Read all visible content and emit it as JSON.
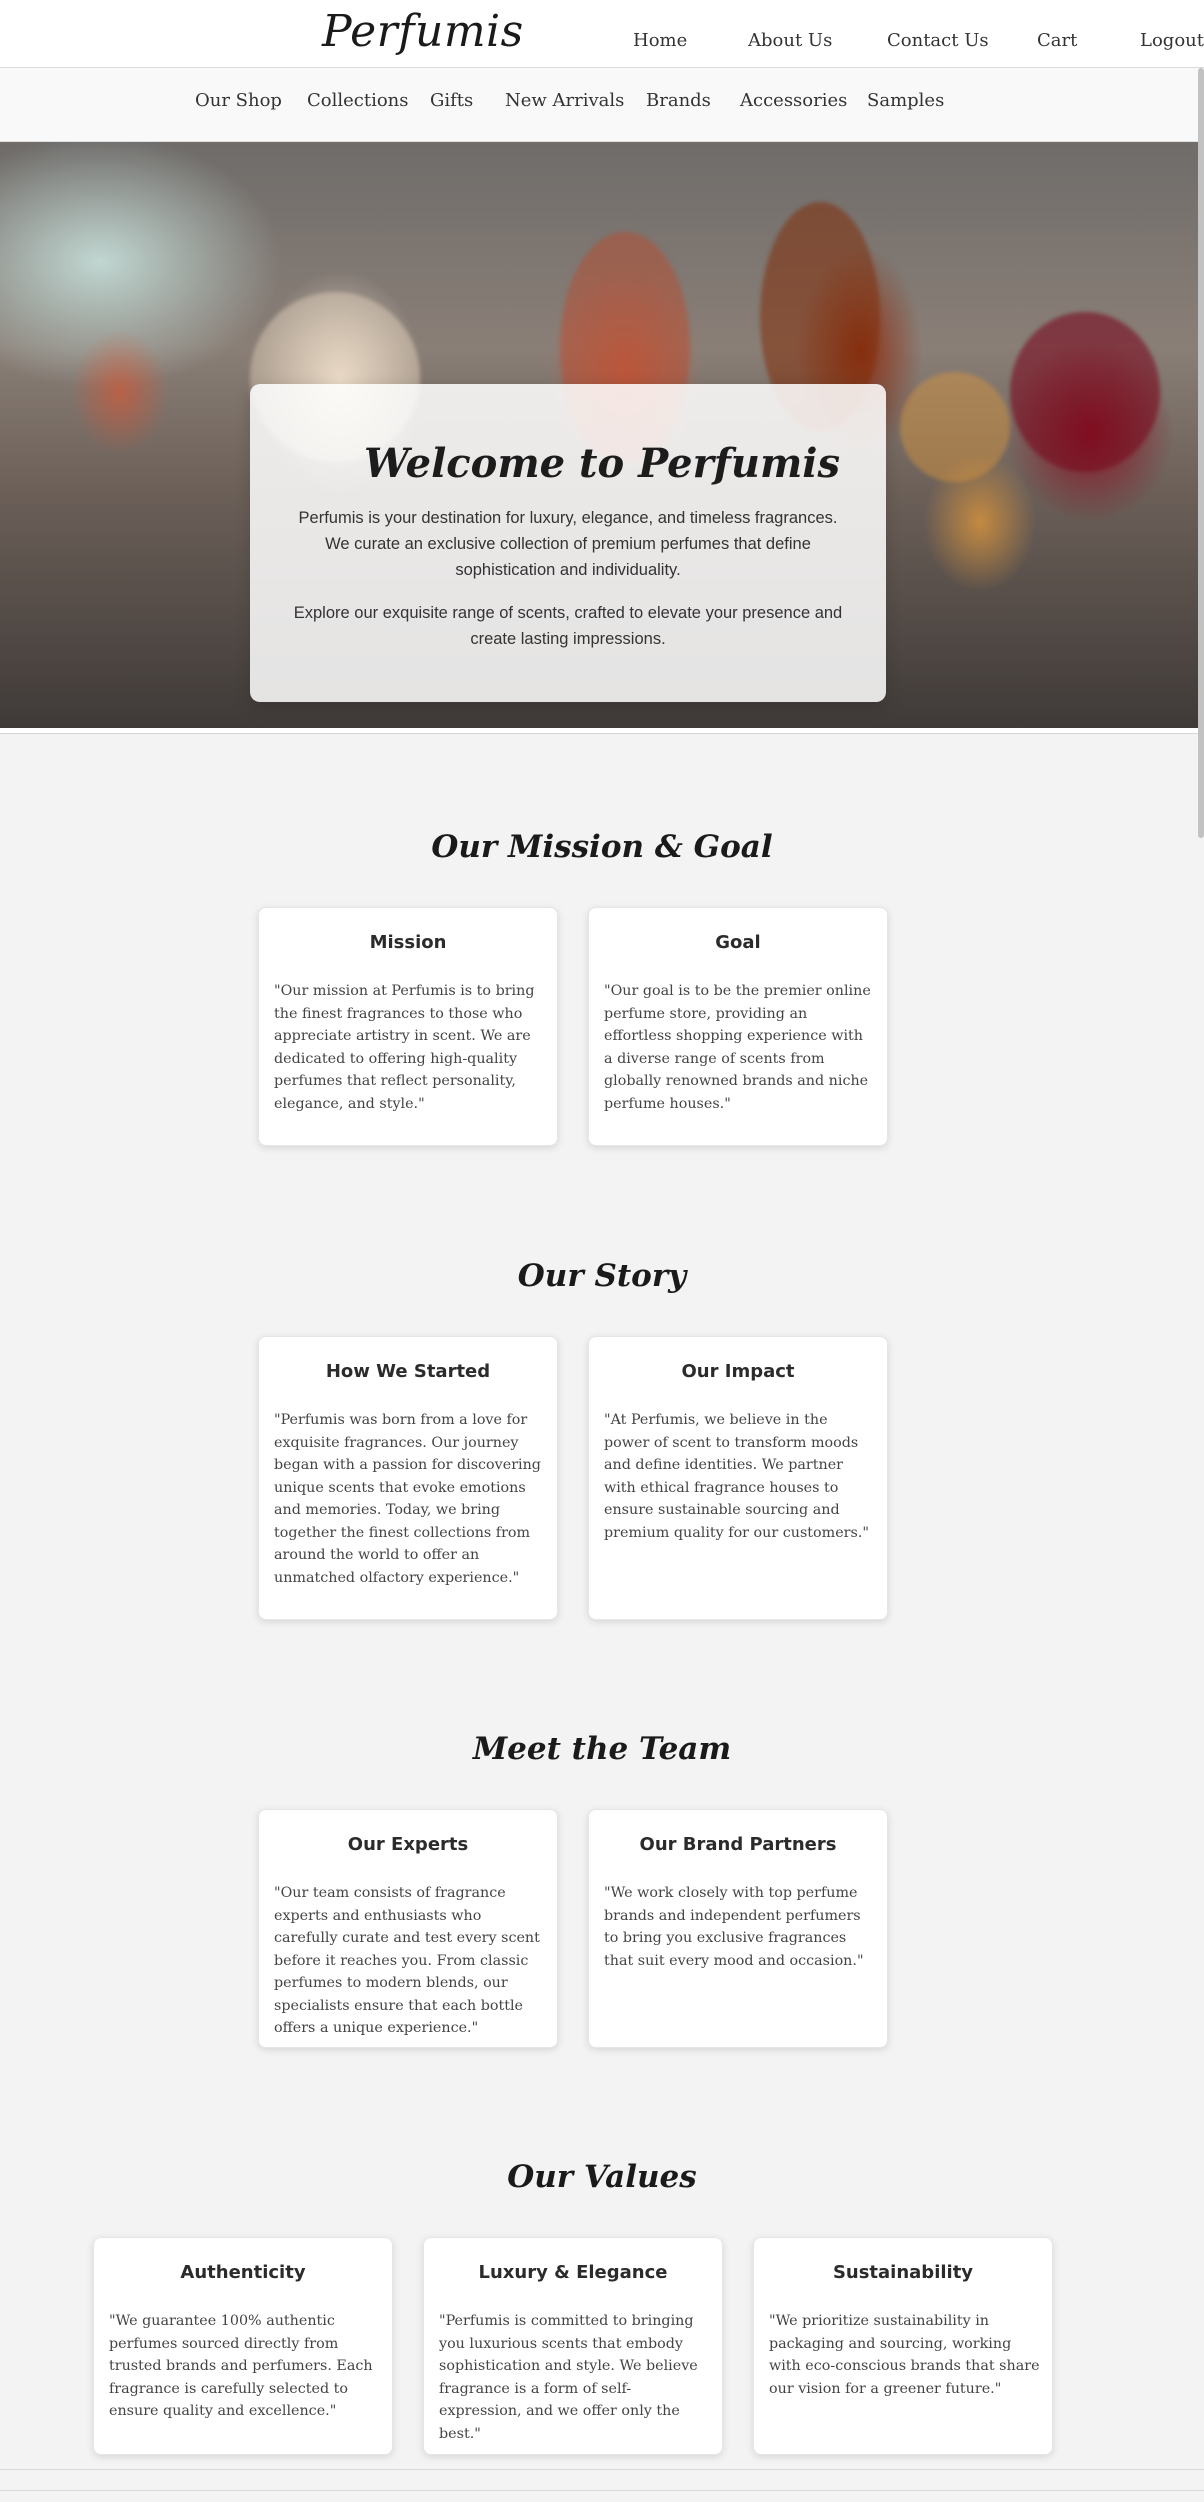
{
  "brand": {
    "logo": "Perfumis"
  },
  "top_nav": [
    {
      "label": "Home"
    },
    {
      "label": "About Us"
    },
    {
      "label": "Contact Us"
    },
    {
      "label": "Cart"
    },
    {
      "label": "Logout"
    }
  ],
  "sub_nav": [
    {
      "label": "Our Shop"
    },
    {
      "label": "Collections"
    },
    {
      "label": "Gifts"
    },
    {
      "label": "New Arrivals"
    },
    {
      "label": "Brands"
    },
    {
      "label": "Accessories"
    },
    {
      "label": "Samples"
    }
  ],
  "hero": {
    "title": "Welcome to Perfumis",
    "paragraph1": "Perfumis is your destination for luxury, elegance, and timeless fragrances. We curate an exclusive collection of premium perfumes that define sophistication and individuality.",
    "paragraph2": "Explore our exquisite range of scents, crafted to elevate your presence and create lasting impressions."
  },
  "sections": {
    "mission": {
      "title": "Our Mission & Goal",
      "cards": [
        {
          "heading": "Mission",
          "text": "\"Our mission at Perfumis is to bring the finest fragrances to those who appreciate artistry in scent. We are dedicated to offering high-quality perfumes that reflect personality, elegance, and style.\""
        },
        {
          "heading": "Goal",
          "text": "\"Our goal is to be the premier online perfume store, providing an effortless shopping experience with a diverse range of scents from globally renowned brands and niche perfume houses.\""
        }
      ]
    },
    "story": {
      "title": "Our Story",
      "cards": [
        {
          "heading": "How We Started",
          "text": "\"Perfumis was born from a love for exquisite fragrances. Our journey began with a passion for discovering unique scents that evoke emotions and memories. Today, we bring together the finest collections from around the world to offer an unmatched olfactory experience.\""
        },
        {
          "heading": "Our Impact",
          "text": "\"At Perfumis, we believe in the power of scent to transform moods and define identities. We partner with ethical fragrance houses to ensure sustainable sourcing and premium quality for our customers.\""
        }
      ]
    },
    "team": {
      "title": "Meet the Team",
      "cards": [
        {
          "heading": "Our Experts",
          "text": "\"Our team consists of fragrance experts and enthusiasts who carefully curate and test every scent before it reaches you. From classic perfumes to modern blends, our specialists ensure that each bottle offers a unique experience.\""
        },
        {
          "heading": "Our Brand Partners",
          "text": "\"We work closely with top perfume brands and independent perfumers to bring you exclusive fragrances that suit every mood and occasion.\""
        }
      ]
    },
    "values": {
      "title": "Our Values",
      "cards": [
        {
          "heading": "Authenticity",
          "text": "\"We guarantee 100% authentic perfumes sourced directly from trusted brands and perfumers. Each fragrance is carefully selected to ensure quality and excellence.\""
        },
        {
          "heading": "Luxury & Elegance",
          "text": "\"Perfumis is committed to bringing you luxurious scents that embody sophistication and style. We believe fragrance is a form of self-expression, and we offer only the best.\""
        },
        {
          "heading": "Sustainability",
          "text": "\"We prioritize sustainability in packaging and sourcing, working with eco-conscious brands that share our vision for a greener future.\""
        }
      ]
    }
  }
}
